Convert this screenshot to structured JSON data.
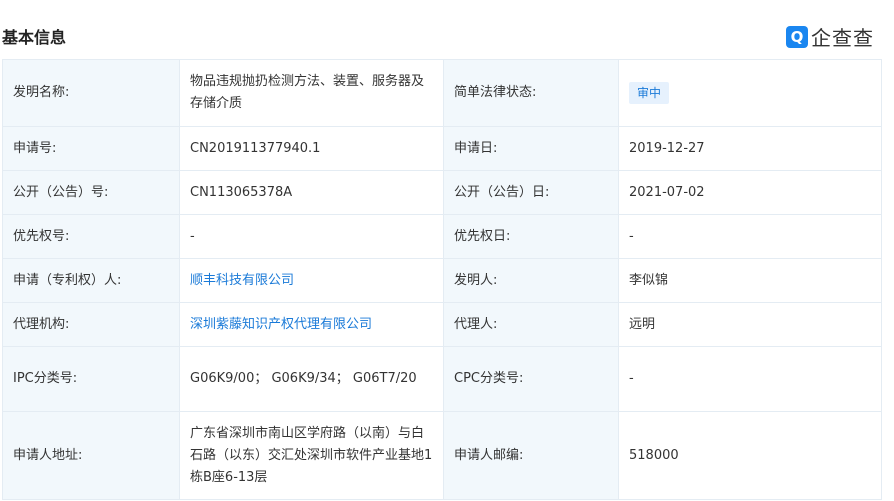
{
  "header": {
    "title": "基本信息",
    "logo_text": "企查查"
  },
  "rows": [
    [
      {
        "label": "发明名称:",
        "value": "物品违规抛扔检测方法、装置、服务器及存储介质"
      },
      {
        "label": "简单法律状态:",
        "value": "审中"
      }
    ],
    [
      {
        "label": "申请号:",
        "value": "CN201911377940.1"
      },
      {
        "label": "申请日:",
        "value": "2019-12-27"
      }
    ],
    [
      {
        "label": "公开（公告）号:",
        "value": "CN113065378A"
      },
      {
        "label": "公开（公告）日:",
        "value": "2021-07-02"
      }
    ],
    [
      {
        "label": "优先权号:",
        "value": "-"
      },
      {
        "label": "优先权日:",
        "value": "-"
      }
    ],
    [
      {
        "label": "申请（专利权）人:",
        "value": "顺丰科技有限公司"
      },
      {
        "label": "发明人:",
        "value": "李似锦"
      }
    ],
    [
      {
        "label": "代理机构:",
        "value": "深圳紫藤知识产权代理有限公司"
      },
      {
        "label": "代理人:",
        "value": "远明"
      }
    ],
    [
      {
        "label": "IPC分类号:",
        "value": "G06K9/00； G06K9/34； G06T7/20"
      },
      {
        "label": "CPC分类号:",
        "value": "-"
      }
    ],
    [
      {
        "label": "申请人地址:",
        "value": "广东省深圳市南山区学府路（以南）与白石路（以东）交汇处深圳市软件产业基地1栋B座6-13层"
      },
      {
        "label": "申请人邮编:",
        "value": "518000"
      }
    ]
  ]
}
